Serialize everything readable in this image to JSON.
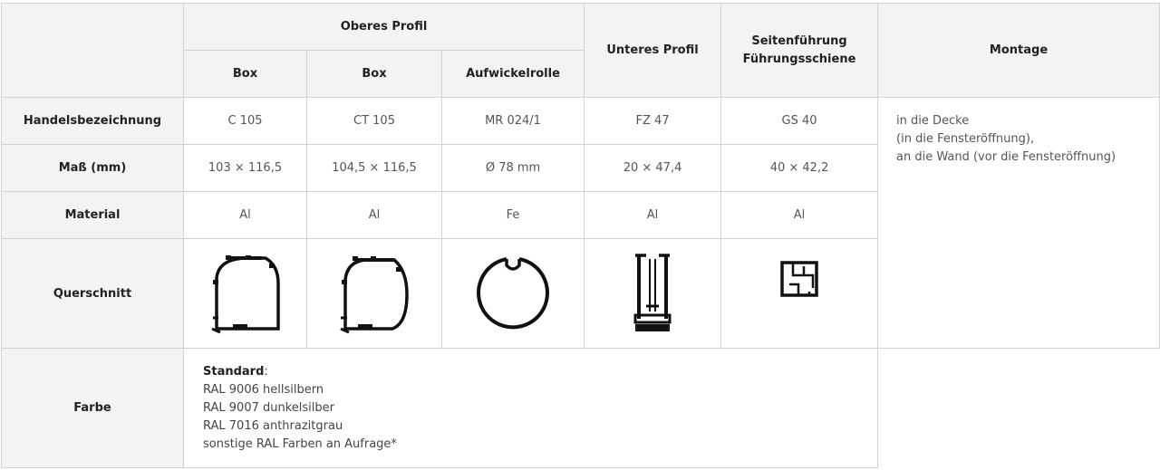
{
  "header": {
    "oberes_profil": "Oberes Profil",
    "box1": "Box",
    "box2": "Box",
    "aufwickelrolle": "Aufwickelrolle",
    "unteres_profil": "Unteres Profil",
    "seitenfuehrung_line1": "Seitenführung",
    "seitenfuehrung_line2": "Führungsschiene",
    "montage": "Montage"
  },
  "rows": {
    "handelsbezeichnung": {
      "label": "Handelsbezeichnung",
      "values": [
        "C 105",
        "CT 105",
        "MR 024/1",
        "FZ 47",
        "GS 40"
      ]
    },
    "mass": {
      "label": "Maß (mm)",
      "values": [
        "103 × 116,5",
        "104,5 × 116,5",
        "Ø 78 mm",
        "20 × 47,4",
        "40 × 42,2"
      ]
    },
    "material": {
      "label": "Material",
      "values": [
        "Al",
        "Al",
        "Fe",
        "Al",
        "Al"
      ]
    },
    "querschnitt": {
      "label": "Querschnitt",
      "icons": [
        "box-profile-c105-icon",
        "box-profile-ct105-icon",
        "roller-tube-icon",
        "bottom-profile-icon",
        "guide-rail-icon"
      ]
    },
    "farbe": {
      "label": "Farbe",
      "standard_label": "Standard",
      "standard_colon": ":",
      "options": [
        "RAL 9006 hellsilbern",
        "RAL 9007 dunkelsilber",
        "RAL 7016 anthrazitgrau",
        "sonstige RAL Farben an Aufrage*"
      ]
    }
  },
  "montage": {
    "lines": [
      "in die Decke",
      "(in die Fensteröffnung),",
      "an die Wand (vor die Fensteröffnung)"
    ]
  },
  "colors": {
    "header_bg": "#f2f3f4",
    "border": "#d3d3d3"
  }
}
